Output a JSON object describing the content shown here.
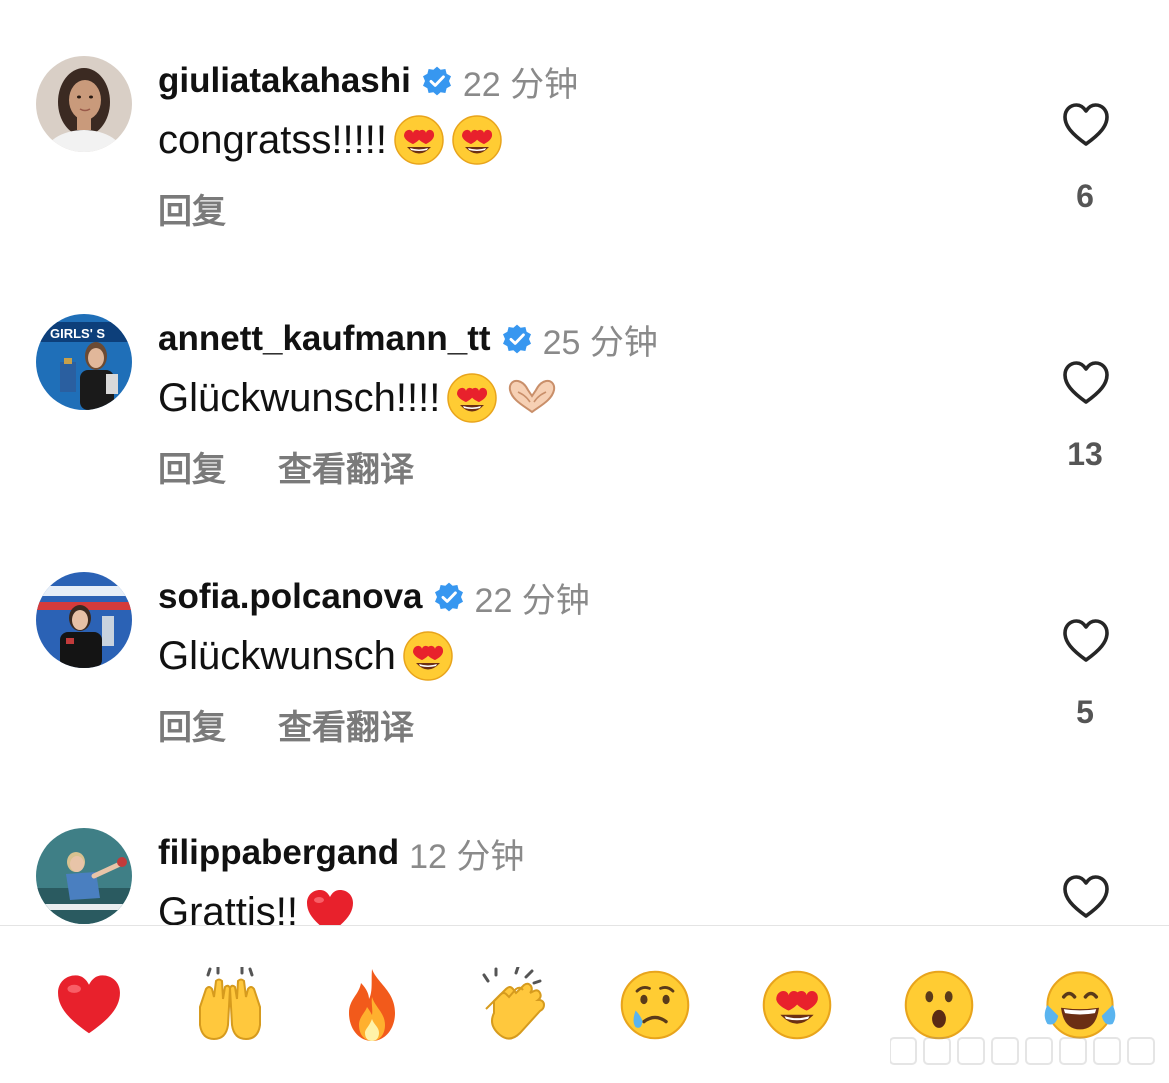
{
  "comments": [
    {
      "username": "giuliatakahashi",
      "verified": true,
      "time": "22 分钟",
      "text": "congratss!!!!!",
      "emojis": [
        "heart-eyes",
        "heart-eyes"
      ],
      "actions": [
        "回复"
      ],
      "likes": "6",
      "avatar": {
        "bg": "#d9cfc6",
        "skin": "#c99a7b",
        "hair": "#3b2a22",
        "shirt": "#f2f2f2"
      }
    },
    {
      "username": "annett_kaufmann_tt",
      "verified": true,
      "time": "25 分钟",
      "text": "Glückwunsch!!!!",
      "emojis": [
        "heart-eyes",
        "heart-hands"
      ],
      "actions": [
        "回复",
        "查看翻译"
      ],
      "likes": "13",
      "avatar": {
        "bg": "#1f6fb8",
        "skin": "#e1b79a",
        "hair": "#6b4a33",
        "shirt": "#1a1a1a",
        "banner": "GIRLS' S"
      }
    },
    {
      "username": "sofia.polcanova",
      "verified": true,
      "time": "22 分钟",
      "text": "Glückwunsch",
      "emojis": [
        "heart-eyes"
      ],
      "actions": [
        "回复",
        "查看翻译"
      ],
      "likes": "5",
      "avatar": {
        "bg": "#2b62b5",
        "skin": "#e6c1a6",
        "hair": "#3a2a20",
        "shirt": "#141414"
      }
    },
    {
      "username": "filippabergand",
      "verified": false,
      "time": "12 分钟",
      "text": "Grattis!!",
      "emojis": [
        "red-heart"
      ],
      "actions": [],
      "likes": "",
      "avatar": {
        "bg": "#3f7f86",
        "skin": "#e8c4a8",
        "hair": "#d8c290",
        "shirt": "#4a7fc0"
      }
    }
  ],
  "reactions": [
    "red-heart",
    "raising-hands",
    "fire",
    "clapping-hands",
    "crying-face",
    "heart-eyes",
    "open-mouth-face",
    "tears-of-joy"
  ],
  "colors": {
    "verified_blue": "#3797f0",
    "like_outline": "#262626",
    "heart_red": "#e8212c",
    "emoji_yellow": "#ffcc33"
  }
}
